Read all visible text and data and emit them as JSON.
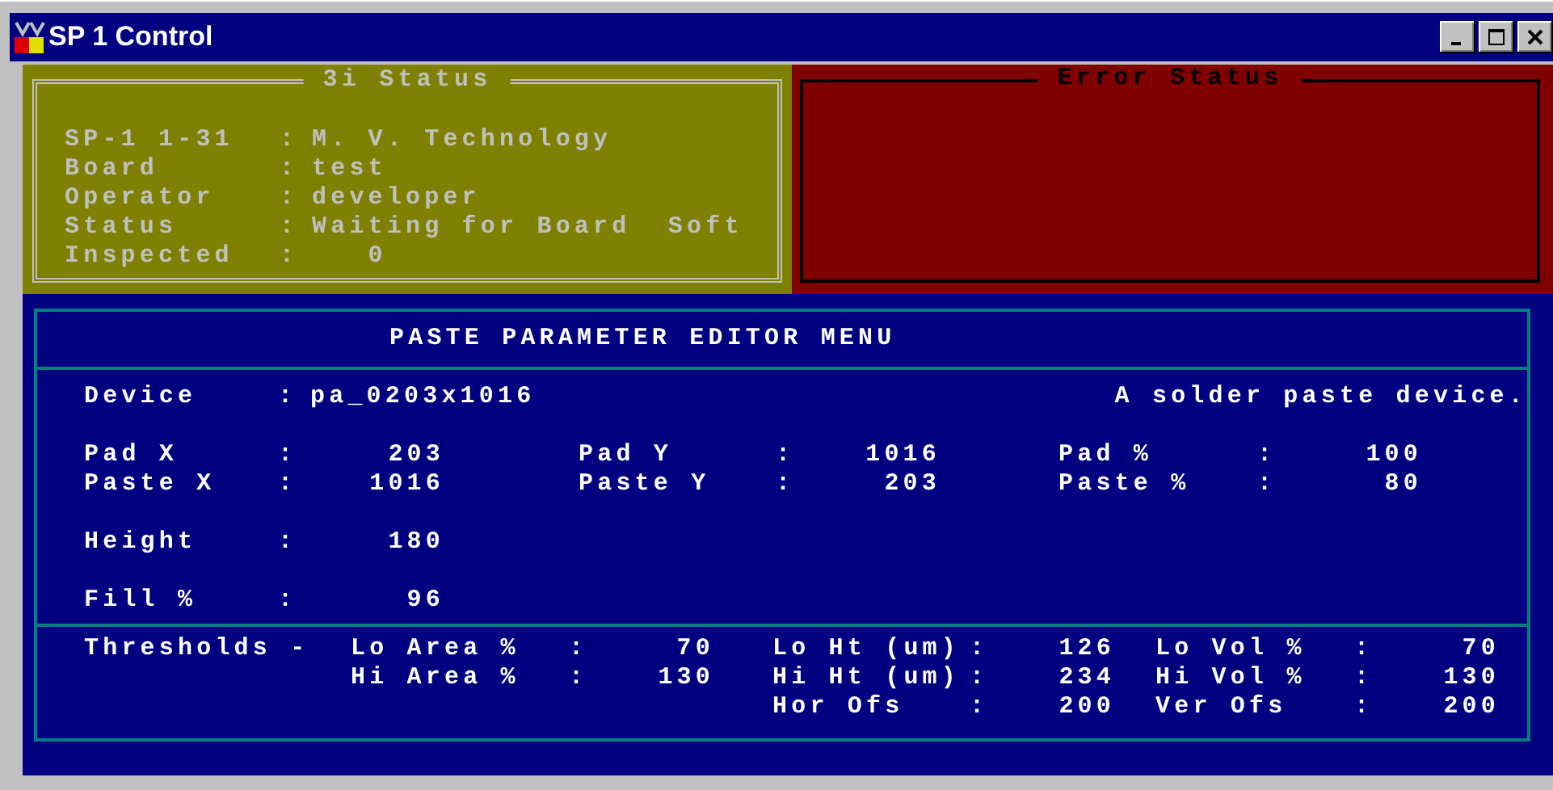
{
  "window": {
    "title": "SP 1 Control"
  },
  "status_panel": {
    "title": "3i Status",
    "rows": [
      {
        "label": "SP-1 1-31",
        "sep": ":",
        "value": "M. V. Technology"
      },
      {
        "label": "Board",
        "sep": ":",
        "value": "test"
      },
      {
        "label": "Operator",
        "sep": ":",
        "value": "developer"
      },
      {
        "label": "Status",
        "sep": ":",
        "value": "Waiting for Board  Soft"
      },
      {
        "label": "Inspected",
        "sep": ":",
        "value": "   0"
      }
    ]
  },
  "error_panel": {
    "title": "Error Status"
  },
  "editor": {
    "title": "PASTE PARAMETER EDITOR MENU",
    "device": {
      "label": "Device",
      "sep": ":",
      "value": "pa_0203x1016",
      "description": "A solder paste device."
    },
    "sections": [
      [
        [
          {
            "label": "Pad X",
            "sep": ":",
            "value": "203"
          },
          {
            "label": "Pad Y",
            "sep": ":",
            "value": "1016"
          },
          {
            "label": "Pad %",
            "sep": ":",
            "value": "100"
          }
        ],
        [
          {
            "label": "Paste X",
            "sep": ":",
            "value": "1016"
          },
          {
            "label": "Paste Y",
            "sep": ":",
            "value": "203"
          },
          {
            "label": "Paste %",
            "sep": ":",
            "value": "80"
          }
        ]
      ],
      [
        [
          {
            "label": "Height",
            "sep": ":",
            "value": "180"
          }
        ]
      ],
      [
        [
          {
            "label": "Fill %",
            "sep": ":",
            "value": "96"
          }
        ]
      ]
    ],
    "thresholds": {
      "label": "Thresholds -",
      "columns": [
        [
          {
            "label": "Lo Area %",
            "sep": ":",
            "value": "70"
          },
          {
            "label": "Hi Area %",
            "sep": ":",
            "value": "130"
          }
        ],
        [
          {
            "label": "Lo Ht (um)",
            "sep": ":",
            "value": "126"
          },
          {
            "label": "Hi Ht (um)",
            "sep": ":",
            "value": "234"
          },
          {
            "label": "Hor Ofs",
            "sep": ":",
            "value": "200"
          }
        ],
        [
          {
            "label": "Lo Vol %",
            "sep": ":",
            "value": "70"
          },
          {
            "label": "Hi Vol %",
            "sep": ":",
            "value": "130"
          },
          {
            "label": "Ver Ofs",
            "sep": ":",
            "value": "200"
          }
        ]
      ]
    }
  }
}
